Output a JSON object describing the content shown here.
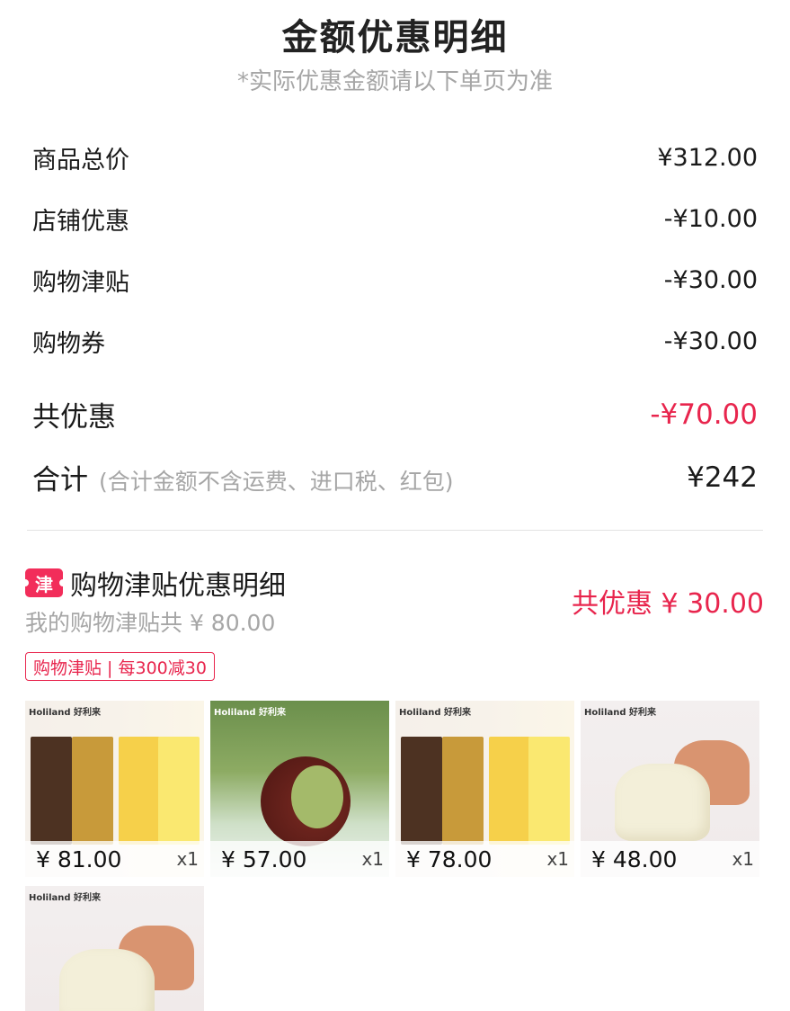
{
  "header": {
    "title": "金额优惠明细",
    "subtitle": "*实际优惠金额请以下单页为准"
  },
  "breakdown": {
    "goods_total": {
      "label": "商品总价",
      "value": "¥312.00"
    },
    "shop_discount": {
      "label": "店铺优惠",
      "value": "-¥10.00"
    },
    "allowance": {
      "label": "购物津贴",
      "value": "-¥30.00"
    },
    "coupon": {
      "label": "购物券",
      "value": "-¥30.00"
    },
    "total_discount": {
      "label": "共优惠",
      "value": "-¥70.00"
    },
    "sum": {
      "label": "合计",
      "note": "(合计金额不含运费、进口税、红包)",
      "value": "¥242"
    }
  },
  "allowance_detail": {
    "icon_char": "津",
    "title": "购物津贴优惠明细",
    "my_allowance": "我的购物津贴共 ¥ 80.00",
    "discount_total": "共优惠 ¥ 30.00",
    "rule_tag": "购物津贴 | 每300减30"
  },
  "products": [
    {
      "price": "¥ 81.00",
      "qty": "x1",
      "brand": "Holiland 好利来",
      "style": "choco"
    },
    {
      "price": "¥ 57.00",
      "qty": "x1",
      "brand": "Holiland 好利来",
      "style": "matcha"
    },
    {
      "price": "¥ 78.00",
      "qty": "x1",
      "brand": "Holiland 好利来",
      "style": "choco"
    },
    {
      "price": "¥ 48.00",
      "qty": "x1",
      "brand": "Holiland 好利来",
      "style": "cake"
    },
    {
      "price": "",
      "qty": "",
      "brand": "Holiland 好利来",
      "style": "cake"
    }
  ],
  "colors": {
    "accent": "#e8254d",
    "muted": "#a6a6a6",
    "text": "#1a1a1a"
  }
}
